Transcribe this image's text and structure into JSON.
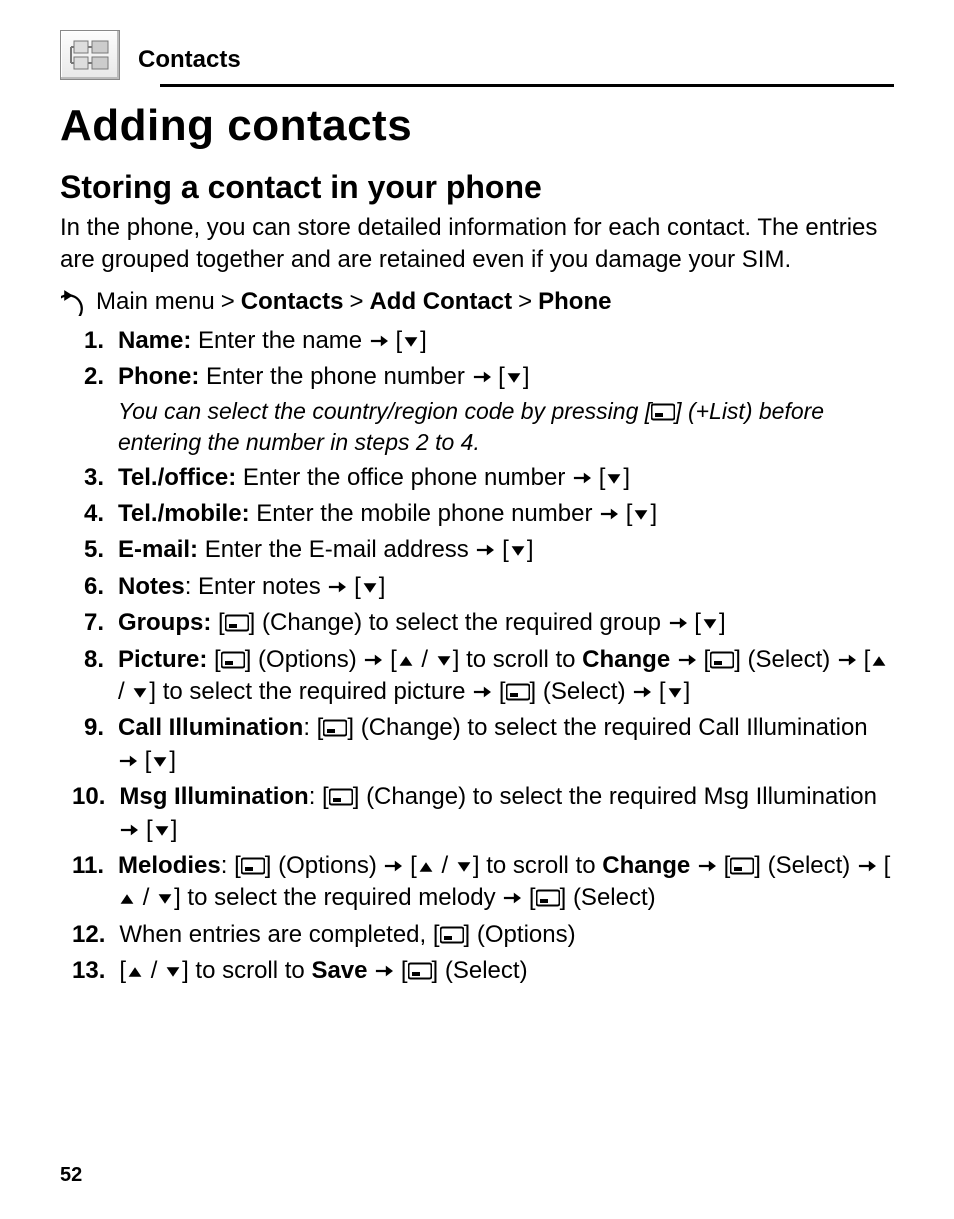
{
  "header": {
    "section": "Contacts"
  },
  "title": "Adding contacts",
  "section_title": "Storing a contact in your phone",
  "intro": "In the phone, you can store detailed information for each contact. The entries are grouped together and are retained even if you damage your SIM.",
  "nav": {
    "prefix": "Main menu",
    "sep": ">",
    "items": [
      "Contacts",
      "Add Contact",
      "Phone"
    ]
  },
  "steps": {
    "s1": {
      "num": "1.",
      "label": "Name:",
      "text": "Enter the name"
    },
    "s2": {
      "num": "2.",
      "label": "Phone:",
      "text": "Enter the phone number",
      "note_a": "You can select the country/region code by pressing",
      "note_b": "(+List)",
      "note_c": "before entering the number in steps 2 to 4."
    },
    "s3": {
      "num": "3.",
      "label": "Tel./office:",
      "text": "Enter the office phone number"
    },
    "s4": {
      "num": "4.",
      "label": "Tel./mobile:",
      "text": "Enter the mobile phone number"
    },
    "s5": {
      "num": "5.",
      "label": "E-mail:",
      "text": "Enter the E-mail address"
    },
    "s6": {
      "num": "6.",
      "label": "Notes",
      "text": ": Enter notes"
    },
    "s7": {
      "num": "7.",
      "label": "Groups:",
      "text_a": "(Change) to select the required group"
    },
    "s8": {
      "num": "8.",
      "label": "Picture:",
      "options": "(Options)",
      "change": "Change",
      "select1": "(Select)",
      "mid": "to select the required picture",
      "select2": "(Select)",
      "scroll": "to scroll to"
    },
    "s9": {
      "num": "9.",
      "label": "Call Illumination",
      "change": "(Change) to select the required Call Illumination"
    },
    "s10": {
      "num": "10.",
      "label": "Msg Illumination",
      "change": "(Change) to select the required Msg Illumination"
    },
    "s11": {
      "num": "11.",
      "label": "Melodies",
      "options": "(Options)",
      "scroll": "to scroll to",
      "change": "Change",
      "select1": "(Select)",
      "mid": "to select the required melody",
      "select2": "(Select)"
    },
    "s12": {
      "num": "12.",
      "text": "When entries are completed,",
      "options": "(Options)"
    },
    "s13": {
      "num": "13.",
      "scroll": "to scroll to",
      "save": "Save",
      "select": "(Select)"
    }
  },
  "page_number": "52"
}
